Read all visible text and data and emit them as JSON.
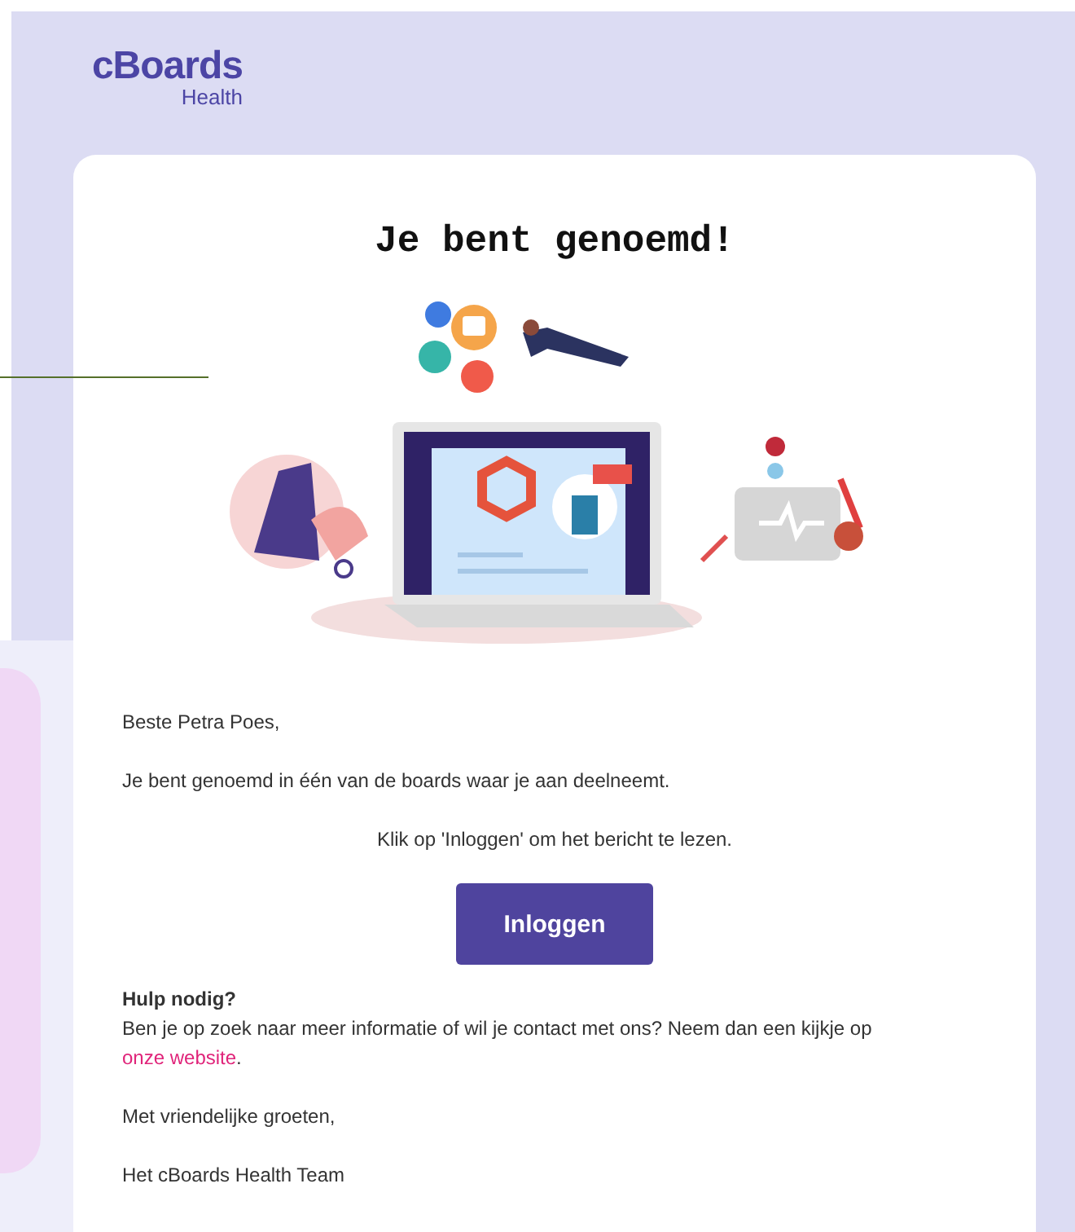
{
  "logo": {
    "name": "cBoards",
    "sub": "Health"
  },
  "email": {
    "title": "Je bent genoemd!",
    "greeting": "Beste Petra Poes,",
    "message": "Je bent genoemd in één van de boards waar je aan deelneemt.",
    "instruction": "Klik op 'Inloggen' om het bericht te lezen.",
    "button": "Inloggen",
    "help_heading": "Hulp nodig?",
    "help_text": "Ben je op zoek naar meer informatie of wil je contact met ons? Neem dan een kijkje op",
    "help_link": "onze website",
    "help_end": ".",
    "closing": "Met vriendelijke groeten,",
    "signature": "Het cBoards Health Team"
  }
}
